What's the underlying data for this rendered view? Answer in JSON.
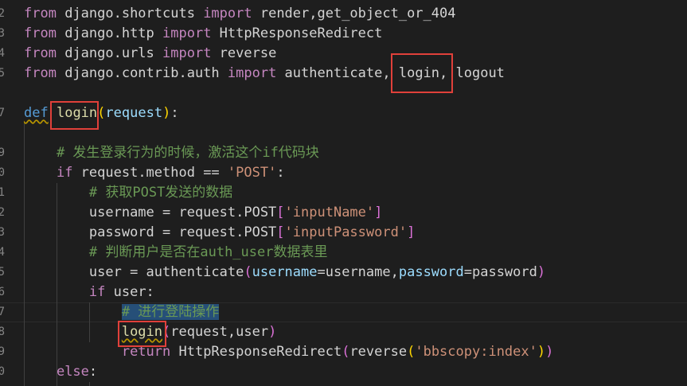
{
  "code": {
    "line_numbers": [
      "2",
      "3",
      "4",
      "5",
      "",
      "7",
      "",
      "9",
      "0",
      "1",
      "2",
      "3",
      "4",
      "5",
      "6",
      "7",
      "8",
      "9",
      "0"
    ],
    "l0": {
      "kw1": "from",
      "mod": " django.shortcuts ",
      "kw2": "import",
      "rest": " render,get_object_or_404"
    },
    "l1": {
      "kw1": "from",
      "mod": " django.http ",
      "kw2": "import",
      "rest": " HttpResponseRedirect"
    },
    "l2": {
      "kw1": "from",
      "mod": " django.urls ",
      "kw2": "import",
      "rest": " reverse"
    },
    "l3": {
      "kw1": "from",
      "mod": " django.contrib.auth ",
      "kw2": "import",
      "a": " authenticate,",
      "b": " login,",
      "c": " logout"
    },
    "l5": {
      "def": "def",
      "sp": " ",
      "name": "login",
      "open": "(",
      "param": "request",
      "close": ")",
      "colon": ":"
    },
    "l7": {
      "indent": "    ",
      "comment": "# 发生登录行为的时候，激活这个if代码块"
    },
    "l8": {
      "indent": "    ",
      "kw": "if",
      "a": " request.method == ",
      "str": "'POST'",
      "colon": ":"
    },
    "l9": {
      "indent": "        ",
      "comment": "# 获取POST发送的数据"
    },
    "l10": {
      "indent": "        ",
      "a": "username = request.POST",
      "open": "[",
      "str": "'inputName'",
      "close": "]"
    },
    "l11": {
      "indent": "        ",
      "a": "password = request.POST",
      "open": "[",
      "str": "'inputPassword'",
      "close": "]"
    },
    "l12": {
      "indent": "        ",
      "comment": "# 判断用户是否在auth_user数据表里"
    },
    "l13": {
      "indent": "        ",
      "a": "user = authenticate",
      "open": "(",
      "p1": "username",
      "eq1": "=username,",
      "p2": "password",
      "eq2": "=password",
      "close": ")"
    },
    "l14": {
      "indent": "        ",
      "kw": "if",
      "a": " user:"
    },
    "l15": {
      "indent": "            ",
      "comment": "# 进行登陆操作"
    },
    "l16": {
      "indent": "            ",
      "name": "login",
      "open": "(",
      "a": "request,user",
      "close": ")"
    },
    "l17": {
      "indent": "            ",
      "kw": "return",
      "a": " HttpResponseRedirect",
      "o1": "(",
      "b": "reverse",
      "o2": "(",
      "str": "'bbscopy:index'",
      "c2": ")",
      "c1": ")"
    },
    "l18": {
      "indent": "    ",
      "kw": "else",
      "colon": ":"
    }
  },
  "colors": {
    "background": "#1e1e1e",
    "highlight_box": "#e0403a",
    "keyword": "#569cd6",
    "control": "#c586c0",
    "function": "#dcdcaa",
    "string": "#ce9178",
    "comment": "#6a9955",
    "param": "#9cdcfe"
  }
}
